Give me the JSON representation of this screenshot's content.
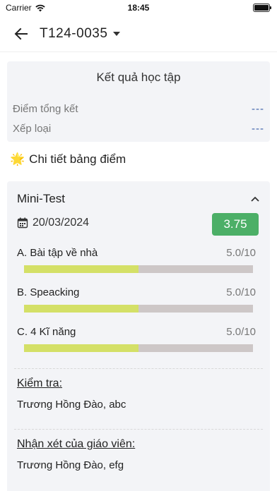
{
  "status_bar": {
    "carrier": "Carrier",
    "time": "18:45"
  },
  "app_bar": {
    "title": "T124-0035"
  },
  "summary": {
    "heading": "Kết quả học tập",
    "rows": [
      {
        "label": "Điểm tổng kết",
        "value": "---"
      },
      {
        "label": "Xếp loại",
        "value": "---"
      }
    ]
  },
  "section": {
    "emoji": "🌟",
    "title": "Chi tiết bảng điểm"
  },
  "test": {
    "name": "Mini-Test",
    "date": "20/03/2024",
    "score": "3.75",
    "items": [
      {
        "label": "A. Bài tập về nhà",
        "score": "5.0/10",
        "fraction": 0.5
      },
      {
        "label": "B. Speacking",
        "score": "5.0/10",
        "fraction": 0.5
      },
      {
        "label": "C. 4 Kĩ năng",
        "score": "5.0/10",
        "fraction": 0.5
      }
    ],
    "check_heading": "Kiểm tra:",
    "check_text": "Trương Hồng Đào,   abc",
    "comment_heading": "Nhận xét của giáo viên:",
    "comment_text": "Trương Hồng Đào,   efg"
  },
  "colors": {
    "score_badge": "#4caf67",
    "progress_fill": "#d4e067",
    "progress_track": "#cdc7c7",
    "panel_bg": "#f3f4f7",
    "placeholder_value": "#3a5ea8"
  }
}
